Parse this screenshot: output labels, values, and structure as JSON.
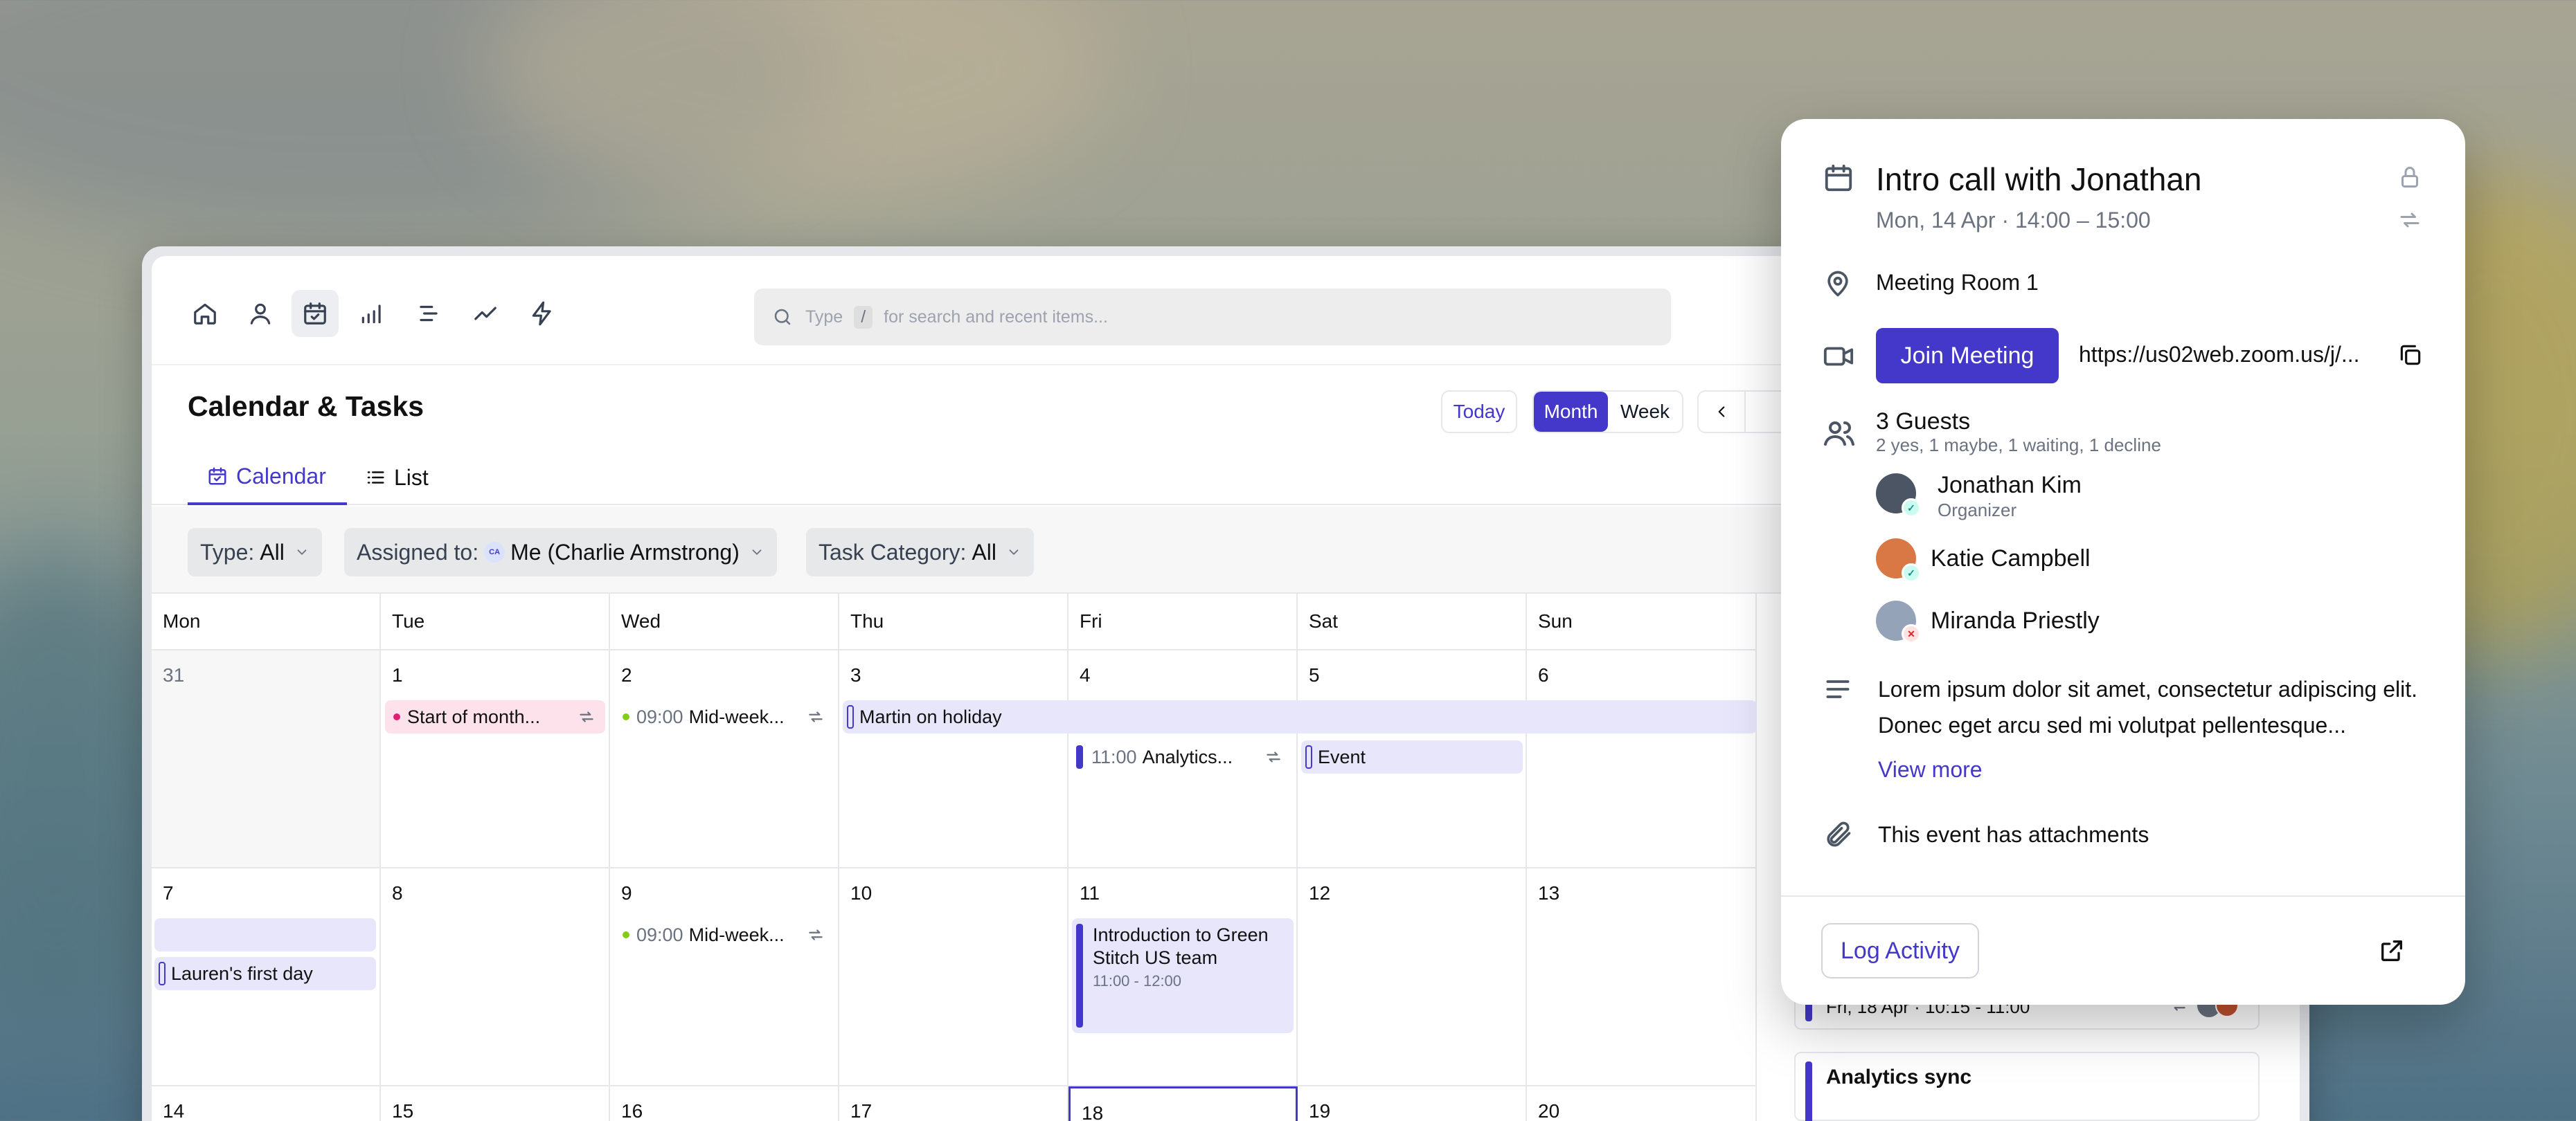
{
  "search": {
    "prefix": "Type",
    "key": "/",
    "hint": "for search and recent items..."
  },
  "header": {
    "title": "Calendar & Tasks",
    "today": "Today",
    "month": "Month",
    "week": "Week"
  },
  "tabs": {
    "calendar": "Calendar",
    "list": "List"
  },
  "filters": {
    "type_label": "Type:",
    "type_value": "All",
    "assigned_label": "Assigned to:",
    "assigned_initials": "CA",
    "assigned_value": "Me (Charlie Armstrong)",
    "category_label": "Task Category:",
    "category_value": "All"
  },
  "days": [
    "Mon",
    "Tue",
    "Wed",
    "Thu",
    "Fri",
    "Sat",
    "Sun"
  ],
  "weeks": [
    [
      "31",
      "1",
      "2",
      "3",
      "4",
      "5",
      "6"
    ],
    [
      "7",
      "8",
      "9",
      "10",
      "11",
      "12",
      "13"
    ],
    [
      "14",
      "15",
      "16",
      "17",
      "18",
      "19",
      "20"
    ]
  ],
  "events": {
    "start_of_month": "Start of month...",
    "mid_week_time": "09:00",
    "mid_week": "Mid-week...",
    "martin_holiday": "Martin on holiday",
    "analytics_time": "11:00",
    "analytics": "Analytics...",
    "event": "Event",
    "lauren": "Lauren's first day",
    "mid_week2_time": "09:00",
    "mid_week2": "Mid-week...",
    "green_stitch": "Introduction to Green Stitch US team",
    "green_stitch_time": "11:00 - 12:00"
  },
  "side": {
    "card1_time": "Fri, 18 Apr · 10:15 - 11:00",
    "card2_title": "Analytics sync"
  },
  "popover": {
    "title": "Intro call with Jonathan",
    "datetime": "Mon, 14 Apr · 14:00 – 15:00",
    "location": "Meeting Room 1",
    "join": "Join Meeting",
    "url": "https://us02web.zoom.us/j/...",
    "guests_title": "3 Guests",
    "guests_summary": "2 yes, 1 maybe, 1 waiting, 1 decline",
    "guests": [
      {
        "name": "Jonathan Kim",
        "role": "Organizer"
      },
      {
        "name": "Katie Campbell"
      },
      {
        "name": "Miranda Priestly"
      }
    ],
    "description": "Lorem ipsum dolor sit amet, consectetur adipiscing elit. Donec eget arcu sed mi volutpat pellentesque...",
    "view_more": "View more",
    "attachments": "This event has attachments",
    "log_activity": "Log Activity"
  },
  "colors": {
    "accent": "#4338ca",
    "event_pink": "#fde2ec",
    "event_lavender": "#e8e6fb",
    "event_green": "#84cc16"
  }
}
